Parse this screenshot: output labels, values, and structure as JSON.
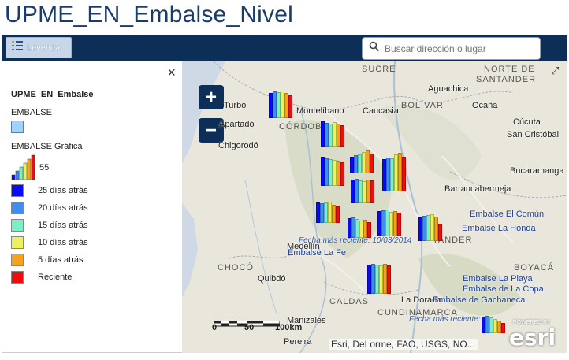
{
  "app": {
    "title": "UPME_EN_Embalse_Nivel"
  },
  "toolbar": {
    "legend_label": "Leyenda",
    "search_placeholder": "Buscar dirección o lugar"
  },
  "legend": {
    "close_glyph": "×",
    "layer_title": "UPME_EN_Embalse",
    "embalse_label": "EMBALSE",
    "embalse_color": "#9fd3f7",
    "grafica_label": "EMBALSE Gráfica",
    "grafica_value": "55",
    "entries": [
      {
        "label": "25 días atrás",
        "color": "#0a0af5"
      },
      {
        "label": "20 días atrás",
        "color": "#3d8ef2"
      },
      {
        "label": "15 días atrás",
        "color": "#7af0c8"
      },
      {
        "label": "10 días atrás",
        "color": "#eef25a"
      },
      {
        "label": "5 días atrás",
        "color": "#f7a21b"
      },
      {
        "label": "Reciente",
        "color": "#f20d0d"
      }
    ]
  },
  "map": {
    "zoom_in": "+",
    "zoom_out": "−",
    "places": [
      {
        "name": "Turbo"
      },
      {
        "name": "Apartadó"
      },
      {
        "name": "Chigorodó"
      },
      {
        "name": "Montelíbano"
      },
      {
        "name": "Caucasia"
      },
      {
        "name": "Aguachica"
      },
      {
        "name": "Ocaña"
      },
      {
        "name": "Cúcuta"
      },
      {
        "name": "San Cristóbal"
      },
      {
        "name": "Bucaramanga"
      },
      {
        "name": "Barrancabermeja"
      },
      {
        "name": "Medellín"
      },
      {
        "name": "Quibdó"
      },
      {
        "name": "Manizales"
      },
      {
        "name": "La Dorada"
      },
      {
        "name": "Pereira"
      }
    ],
    "regions": [
      {
        "name": "SUCRE"
      },
      {
        "name": "BOLÍVAR"
      },
      {
        "name": "NORTE DE"
      },
      {
        "name": "SANTANDER"
      },
      {
        "name": "CÓRDOBA"
      },
      {
        "name": "TANDER"
      },
      {
        "name": "CHOCÓ"
      },
      {
        "name": "CALDAS"
      },
      {
        "name": "BOYACÁ"
      },
      {
        "name": "CUNDINAMARCA"
      }
    ],
    "reservoirs": [
      {
        "name": "Embalse El Común"
      },
      {
        "name": "Embalse La Honda"
      },
      {
        "name": "Embalse La Fe"
      },
      {
        "name": "Embalse La Playa"
      },
      {
        "name": "Embalse de La Copa"
      },
      {
        "name": "Embalse de Gachaneca"
      }
    ],
    "date_labels": [
      {
        "text": "Fecha más reciente: 10/03/2014"
      },
      {
        "text": "Fecha más reciente:"
      }
    ],
    "scale": {
      "labels": [
        "0",
        "50",
        "100km"
      ]
    },
    "attribution": "Esri, DeLorme, FAO, USGS, NO...",
    "esri_logo": "esri",
    "powered_by": "POWERED BY",
    "bar_charts": [
      {
        "levels": [
          0.62,
          0.66,
          0.64,
          0.68,
          0.62,
          0.55
        ]
      },
      {
        "levels": [
          0.62,
          0.58,
          0.55,
          0.6,
          0.55,
          0.52
        ]
      },
      {
        "levels": [
          0.72,
          0.68,
          0.66,
          0.64,
          0.6,
          0.58
        ]
      },
      {
        "levels": [
          0.4,
          0.44,
          0.46,
          0.52,
          0.55,
          0.48
        ]
      },
      {
        "levels": [
          0.78,
          0.82,
          0.8,
          0.9,
          0.95,
          0.85
        ]
      },
      {
        "levels": [
          0.5,
          0.48,
          0.5,
          0.52,
          0.45,
          0.4
        ]
      },
      {
        "levels": [
          0.58,
          0.6,
          0.56,
          0.54,
          0.58,
          0.55
        ]
      },
      {
        "levels": [
          0.48,
          0.5,
          0.46,
          0.42,
          0.45,
          0.38
        ]
      },
      {
        "levels": [
          0.62,
          0.64,
          0.66,
          0.6,
          0.62,
          0.58
        ]
      },
      {
        "levels": [
          0.58,
          0.62,
          0.64,
          0.66,
          0.6,
          0.42
        ]
      },
      {
        "levels": [
          0.72,
          0.74,
          0.72,
          0.7,
          0.74,
          0.7
        ]
      },
      {
        "levels": [
          0.4,
          0.42,
          0.38,
          0.35,
          0.3,
          0.25
        ]
      }
    ]
  }
}
